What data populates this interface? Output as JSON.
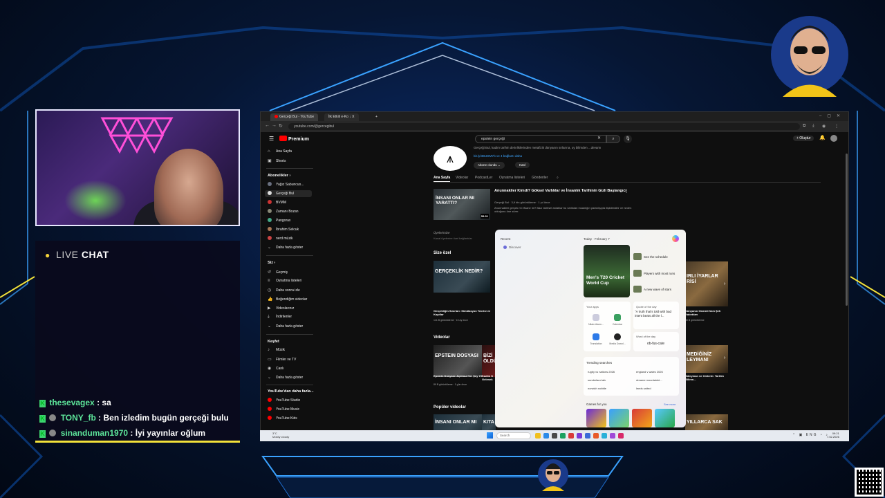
{
  "chat": {
    "live": "LIVE",
    "chat": "CHAT",
    "messages": [
      {
        "user": "thesevagex",
        "text": ": sa"
      },
      {
        "user": "TONY_fb",
        "text": ": Ben izledim bugün gerçeği bulu"
      },
      {
        "user": "sinanduman1970",
        "text": ": İyi yayınlar oğlum"
      }
    ]
  },
  "browser": {
    "tabs": [
      "Gerçeği Bul - YouTube",
      "İlk Etkili e-Ko ↓ X"
    ],
    "url": "youtube.com/@gercegibul",
    "colors": {
      "accent": "#ff0000",
      "link": "#3ea6ff",
      "bg": "#0f0f0f"
    }
  },
  "youtube": {
    "logo": "Premium",
    "search_value": "epstein gerçeği",
    "create_label": "+ Oluştur",
    "sidebar": {
      "home": "Ana Sayfa",
      "shorts": "Shorts",
      "subs_head": "Abonelikler ›",
      "subs": [
        "Yağız Sabuncuo...",
        "Gerçeği Bul",
        "BVMM",
        "Zamanı Bozan",
        "Pangorax",
        "İbrahim Selcuk",
        "nerd müzik",
        "Daha fazla göster"
      ],
      "you_head": "Siz ›",
      "you": [
        "Geçmiş",
        "Oynatma listeleri",
        "Daha sonra izle",
        "Beğendiğim videolar",
        "Videolarınız",
        "İndirilenler",
        "Daha fazla göster"
      ],
      "explore_head": "Keşfet",
      "explore": [
        "Müzik",
        "Filmler ve TV",
        "Canlı",
        "Daha fazla göster"
      ],
      "more_head": "YouTube'dan daha fazla...",
      "more": [
        "YouTube Studio",
        "YouTube Music",
        "YouTube Kids"
      ]
    },
    "channel": {
      "desc": "Gerçeği Bul, kadim tarihin derinliklerinden metafizik dünyanın sırlarına, uy bilimden ...devamı",
      "links": "bit.ly/3BUDMYb ve 4 bağlantı daha",
      "subscribe": "Abone olundu ⌄",
      "join": "Katıl",
      "tabs": [
        "Ana Sayfa",
        "Videolar",
        "PodcastLer",
        "Oynatma listeleri",
        "Gönderiler"
      ]
    },
    "featured": {
      "thumb": "İNSANI ONLAR MI YARATTI?",
      "duration": "55:51",
      "title": "Anunnakiler Kimdi? Göksel Varlıklar ve İnsanlık Tarihinin Gizli Başlangıcı",
      "meta": "Gerçeği Bul · 3,9 bin görüntüleme · 1 yıl önce",
      "desc": "Anunnakiler gerçek mi efsane mi? Bazı tarihsel anlatılar bu varlıkları insanlığın yaratılışıyla ilişkilendirir ve neden olduğunu öne sürer."
    },
    "playlist_note": "Üyelerimize",
    "playlist_sub": "Kanal üyelerine özel bağlantılar",
    "sections": {
      "s1": "Size özel",
      "s2": "Videolar",
      "s3": "Popüler videolar"
    },
    "card1": {
      "thumb": "GERÇEKLİK NEDİR?",
      "title": "Gerçekliğin Sınırları: Simülasyon Teorisi ve Kayıtlar",
      "meta": "141 B görüntüleme · 10 ay önce"
    },
    "card2": {
      "thumb": "EPSTEIN DOSYASI",
      "title": "Epstein Dosyası: Açılmaz Her Şey Yıkılır",
      "meta": "89 B görüntüleme · 1 gün önce"
    },
    "card2b": {
      "thumb": "BİZİ ÖLDÜ",
      "title": "Kadim K Gelenek"
    },
    "card3": {
      "thumb": "İNSANI ONLAR MI"
    },
    "card4": {
      "thumb": "KITA"
    },
    "right1": {
      "thumb": "IRLI İYARLAR RİSİ",
      "title": "Dünyanın Gizemli İmm Şeh Kalıntıları",
      "meta": "80 B görüntüleme"
    },
    "right2": {
      "thumb": "MEDİĞİNİZ LEYMAN!",
      "title": "Süleyman ve Cinlerin: Tarihin Bilinm..."
    },
    "right3": {
      "thumb": "YILLARCA SAK"
    }
  },
  "widgets": {
    "recent": "Recent",
    "discover": "Discover",
    "today": "Today · February 7",
    "cricket": "Men's T20 Cricket World Cup",
    "news": [
      "See the schedule",
      "Players with most runs",
      "A new wave of stars"
    ],
    "your_apps": "Your apps",
    "apps": [
      "Nitain Alarm...",
      "Calendar",
      "Translation",
      "Media Downl..."
    ],
    "quote_head": "Quote of the day",
    "quote": "\"A truth that's told with bad intent beats all the l...",
    "word_head": "Word of the day",
    "word": "ob-fus-cate",
    "trending_head": "Trending searches",
    "trending": [
      "rugby vs nations 2026",
      "england v wales 2026",
      "sunderland afc",
      "dreame mountainbi...",
      "norwich nobble",
      "leeds united"
    ],
    "games_head": "Games for you",
    "see_more": "See more"
  },
  "taskbar": {
    "weather": "3°C",
    "weather_sub": "Mostly cloudy",
    "search": "Search",
    "time": "09:21",
    "date": "7.02.2026",
    "lang": "ENG"
  }
}
